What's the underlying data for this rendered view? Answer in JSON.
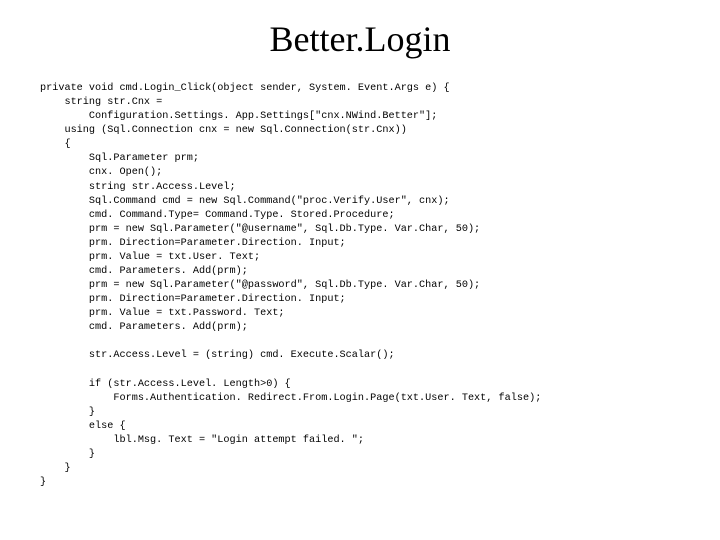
{
  "title": "Better.Login",
  "code_lines": [
    "private void cmd.Login_Click(object sender, System. Event.Args e) {",
    "    string str.Cnx =",
    "        Configuration.Settings. App.Settings[\"cnx.NWind.Better\"];",
    "    using (Sql.Connection cnx = new Sql.Connection(str.Cnx))",
    "    {",
    "        Sql.Parameter prm;",
    "        cnx. Open();",
    "        string str.Access.Level;",
    "        Sql.Command cmd = new Sql.Command(\"proc.Verify.User\", cnx);",
    "        cmd. Command.Type= Command.Type. Stored.Procedure;",
    "        prm = new Sql.Parameter(\"@username\", Sql.Db.Type. Var.Char, 50);",
    "        prm. Direction=Parameter.Direction. Input;",
    "        prm. Value = txt.User. Text;",
    "        cmd. Parameters. Add(prm);",
    "        prm = new Sql.Parameter(\"@password\", Sql.Db.Type. Var.Char, 50);",
    "        prm. Direction=Parameter.Direction. Input;",
    "        prm. Value = txt.Password. Text;",
    "        cmd. Parameters. Add(prm);",
    "",
    "        str.Access.Level = (string) cmd. Execute.Scalar();",
    "",
    "        if (str.Access.Level. Length>0) {",
    "            Forms.Authentication. Redirect.From.Login.Page(txt.User. Text, false);",
    "        }",
    "        else {",
    "            lbl.Msg. Text = \"Login attempt failed. \";",
    "        }",
    "    }",
    "}"
  ]
}
